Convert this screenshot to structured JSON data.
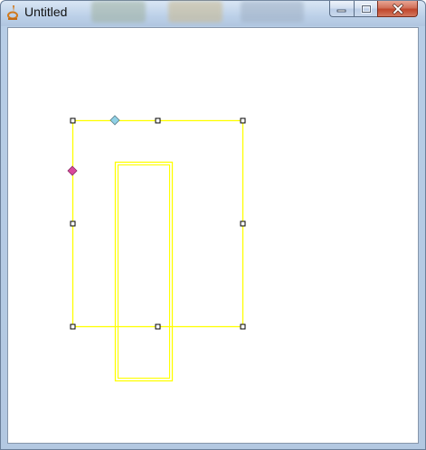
{
  "window": {
    "title": "Untitled"
  },
  "caption": {
    "minimize_icon": "minimize-icon",
    "maximize_icon": "restore-icon",
    "close_icon": "close-x-icon"
  },
  "canvas": {
    "selection_color": "#ffff00",
    "handle_color": "#000000",
    "rotate_handle_color": "#8fd1e6",
    "skew_handle_color": "#d9489c",
    "shapes": [
      "selection-box",
      "inner-rectangle"
    ]
  }
}
